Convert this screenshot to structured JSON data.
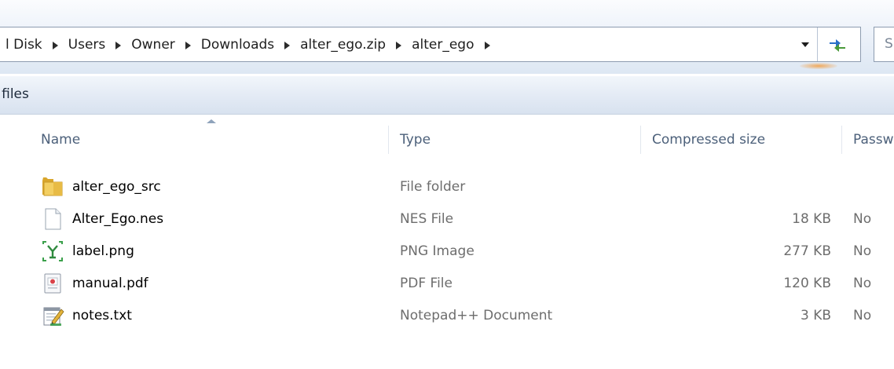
{
  "address_bar": {
    "breadcrumbs": [
      "l Disk",
      "Users",
      "Owner",
      "Downloads",
      "alter_ego.zip",
      "alter_ego"
    ],
    "search_placeholder": "S"
  },
  "toolbar": {
    "extract_all_label": "l files"
  },
  "columns": {
    "name": "Name",
    "type": "Type",
    "compressed_size": "Compressed size",
    "password": "Passw"
  },
  "files": [
    {
      "name": "alter_ego_src",
      "type": "File folder",
      "compressed_size": "",
      "password": "",
      "icon": "folder-icon"
    },
    {
      "name": "Alter_Ego.nes",
      "type": "NES File",
      "compressed_size": "18 KB",
      "password": "No",
      "icon": "blank-file-icon"
    },
    {
      "name": "label.png",
      "type": "PNG Image",
      "compressed_size": "277 KB",
      "password": "No",
      "icon": "image-file-icon"
    },
    {
      "name": "manual.pdf",
      "type": "PDF File",
      "compressed_size": "120 KB",
      "password": "No",
      "icon": "pdf-file-icon"
    },
    {
      "name": "notes.txt",
      "type": "Notepad++ Document",
      "compressed_size": "3 KB",
      "password": "No",
      "icon": "notepad-file-icon"
    }
  ],
  "colors": {
    "header_text": "#4c607a",
    "detail_text": "#6d6d6d",
    "toolbar_top": "#f2f6fb",
    "toolbar_bottom": "#d8e2ef",
    "folder_yellow": "#e8c04a",
    "image_icon_green": "#3aa04a"
  }
}
